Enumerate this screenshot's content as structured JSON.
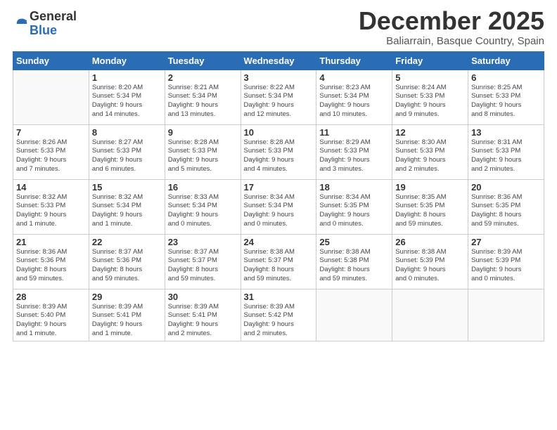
{
  "logo": {
    "general": "General",
    "blue": "Blue"
  },
  "header": {
    "month": "December 2025",
    "location": "Baliarrain, Basque Country, Spain"
  },
  "weekdays": [
    "Sunday",
    "Monday",
    "Tuesday",
    "Wednesday",
    "Thursday",
    "Friday",
    "Saturday"
  ],
  "weeks": [
    [
      {
        "day": "",
        "info": ""
      },
      {
        "day": "1",
        "info": "Sunrise: 8:20 AM\nSunset: 5:34 PM\nDaylight: 9 hours\nand 14 minutes."
      },
      {
        "day": "2",
        "info": "Sunrise: 8:21 AM\nSunset: 5:34 PM\nDaylight: 9 hours\nand 13 minutes."
      },
      {
        "day": "3",
        "info": "Sunrise: 8:22 AM\nSunset: 5:34 PM\nDaylight: 9 hours\nand 12 minutes."
      },
      {
        "day": "4",
        "info": "Sunrise: 8:23 AM\nSunset: 5:34 PM\nDaylight: 9 hours\nand 10 minutes."
      },
      {
        "day": "5",
        "info": "Sunrise: 8:24 AM\nSunset: 5:33 PM\nDaylight: 9 hours\nand 9 minutes."
      },
      {
        "day": "6",
        "info": "Sunrise: 8:25 AM\nSunset: 5:33 PM\nDaylight: 9 hours\nand 8 minutes."
      }
    ],
    [
      {
        "day": "7",
        "info": "Sunrise: 8:26 AM\nSunset: 5:33 PM\nDaylight: 9 hours\nand 7 minutes."
      },
      {
        "day": "8",
        "info": "Sunrise: 8:27 AM\nSunset: 5:33 PM\nDaylight: 9 hours\nand 6 minutes."
      },
      {
        "day": "9",
        "info": "Sunrise: 8:28 AM\nSunset: 5:33 PM\nDaylight: 9 hours\nand 5 minutes."
      },
      {
        "day": "10",
        "info": "Sunrise: 8:28 AM\nSunset: 5:33 PM\nDaylight: 9 hours\nand 4 minutes."
      },
      {
        "day": "11",
        "info": "Sunrise: 8:29 AM\nSunset: 5:33 PM\nDaylight: 9 hours\nand 3 minutes."
      },
      {
        "day": "12",
        "info": "Sunrise: 8:30 AM\nSunset: 5:33 PM\nDaylight: 9 hours\nand 2 minutes."
      },
      {
        "day": "13",
        "info": "Sunrise: 8:31 AM\nSunset: 5:33 PM\nDaylight: 9 hours\nand 2 minutes."
      }
    ],
    [
      {
        "day": "14",
        "info": "Sunrise: 8:32 AM\nSunset: 5:33 PM\nDaylight: 9 hours\nand 1 minute."
      },
      {
        "day": "15",
        "info": "Sunrise: 8:32 AM\nSunset: 5:34 PM\nDaylight: 9 hours\nand 1 minute."
      },
      {
        "day": "16",
        "info": "Sunrise: 8:33 AM\nSunset: 5:34 PM\nDaylight: 9 hours\nand 0 minutes."
      },
      {
        "day": "17",
        "info": "Sunrise: 8:34 AM\nSunset: 5:34 PM\nDaylight: 9 hours\nand 0 minutes."
      },
      {
        "day": "18",
        "info": "Sunrise: 8:34 AM\nSunset: 5:35 PM\nDaylight: 9 hours\nand 0 minutes."
      },
      {
        "day": "19",
        "info": "Sunrise: 8:35 AM\nSunset: 5:35 PM\nDaylight: 8 hours\nand 59 minutes."
      },
      {
        "day": "20",
        "info": "Sunrise: 8:36 AM\nSunset: 5:35 PM\nDaylight: 8 hours\nand 59 minutes."
      }
    ],
    [
      {
        "day": "21",
        "info": "Sunrise: 8:36 AM\nSunset: 5:36 PM\nDaylight: 8 hours\nand 59 minutes."
      },
      {
        "day": "22",
        "info": "Sunrise: 8:37 AM\nSunset: 5:36 PM\nDaylight: 8 hours\nand 59 minutes."
      },
      {
        "day": "23",
        "info": "Sunrise: 8:37 AM\nSunset: 5:37 PM\nDaylight: 8 hours\nand 59 minutes."
      },
      {
        "day": "24",
        "info": "Sunrise: 8:38 AM\nSunset: 5:37 PM\nDaylight: 8 hours\nand 59 minutes."
      },
      {
        "day": "25",
        "info": "Sunrise: 8:38 AM\nSunset: 5:38 PM\nDaylight: 8 hours\nand 59 minutes."
      },
      {
        "day": "26",
        "info": "Sunrise: 8:38 AM\nSunset: 5:39 PM\nDaylight: 9 hours\nand 0 minutes."
      },
      {
        "day": "27",
        "info": "Sunrise: 8:39 AM\nSunset: 5:39 PM\nDaylight: 9 hours\nand 0 minutes."
      }
    ],
    [
      {
        "day": "28",
        "info": "Sunrise: 8:39 AM\nSunset: 5:40 PM\nDaylight: 9 hours\nand 1 minute."
      },
      {
        "day": "29",
        "info": "Sunrise: 8:39 AM\nSunset: 5:41 PM\nDaylight: 9 hours\nand 1 minute."
      },
      {
        "day": "30",
        "info": "Sunrise: 8:39 AM\nSunset: 5:41 PM\nDaylight: 9 hours\nand 2 minutes."
      },
      {
        "day": "31",
        "info": "Sunrise: 8:39 AM\nSunset: 5:42 PM\nDaylight: 9 hours\nand 2 minutes."
      },
      {
        "day": "",
        "info": ""
      },
      {
        "day": "",
        "info": ""
      },
      {
        "day": "",
        "info": ""
      }
    ]
  ]
}
